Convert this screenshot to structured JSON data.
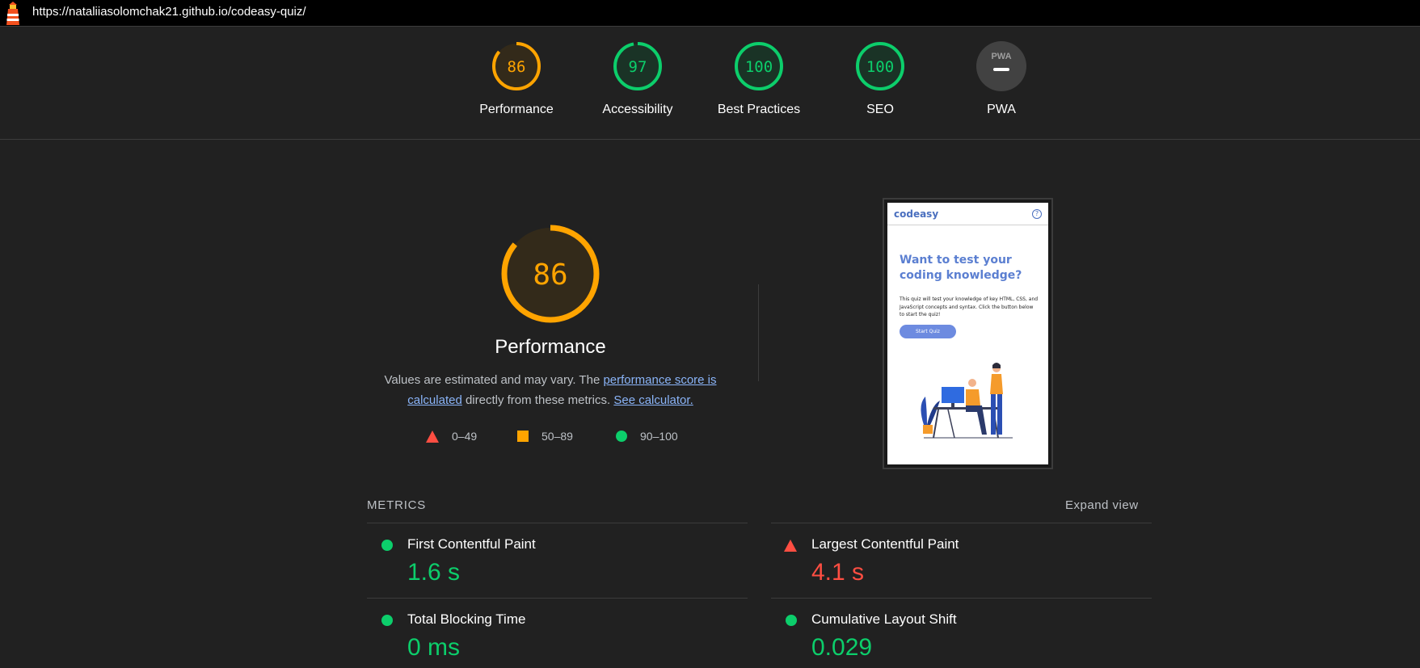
{
  "url": "https://nataliiasolomchak21.github.io/codeasy-quiz/",
  "colors": {
    "pass": "#0cce6b",
    "average": "#ffa400",
    "fail": "#ff4e42",
    "link": "#8ab4f8"
  },
  "gauges": [
    {
      "label": "Performance",
      "score": "86",
      "value": 86,
      "rating": "average"
    },
    {
      "label": "Accessibility",
      "score": "97",
      "value": 97,
      "rating": "pass"
    },
    {
      "label": "Best Practices",
      "score": "100",
      "value": 100,
      "rating": "pass"
    },
    {
      "label": "SEO",
      "score": "100",
      "value": 100,
      "rating": "pass"
    },
    {
      "label": "PWA",
      "badge": "PWA",
      "rating": "pwa"
    }
  ],
  "performance": {
    "score": "86",
    "value": 86,
    "title": "Performance",
    "desc_prefix": "Values are estimated and may vary. The ",
    "desc_link1": "performance score is calculated",
    "desc_middle": " directly from these metrics. ",
    "desc_link2": "See calculator."
  },
  "legend": [
    {
      "shape": "triangle",
      "range": "0–49"
    },
    {
      "shape": "square",
      "range": "50–89"
    },
    {
      "shape": "circle",
      "range": "90–100"
    }
  ],
  "thumbnail": {
    "brand": "codeasy",
    "help": "?",
    "heading": "Want to test your coding knowledge?",
    "text": "This quiz will test your knowledge of key HTML, CSS, and JavaScript concepts and syntax. Click the button below to start the quiz!",
    "button": "Start Quiz"
  },
  "metrics": {
    "label": "METRICS",
    "expand": "Expand view",
    "items": [
      {
        "title": "First Contentful Paint",
        "value": "1.6 s",
        "rating": "pass"
      },
      {
        "title": "Largest Contentful Paint",
        "value": "4.1 s",
        "rating": "fail"
      },
      {
        "title": "Total Blocking Time",
        "value": "0 ms",
        "rating": "pass"
      },
      {
        "title": "Cumulative Layout Shift",
        "value": "0.029",
        "rating": "pass"
      }
    ]
  }
}
